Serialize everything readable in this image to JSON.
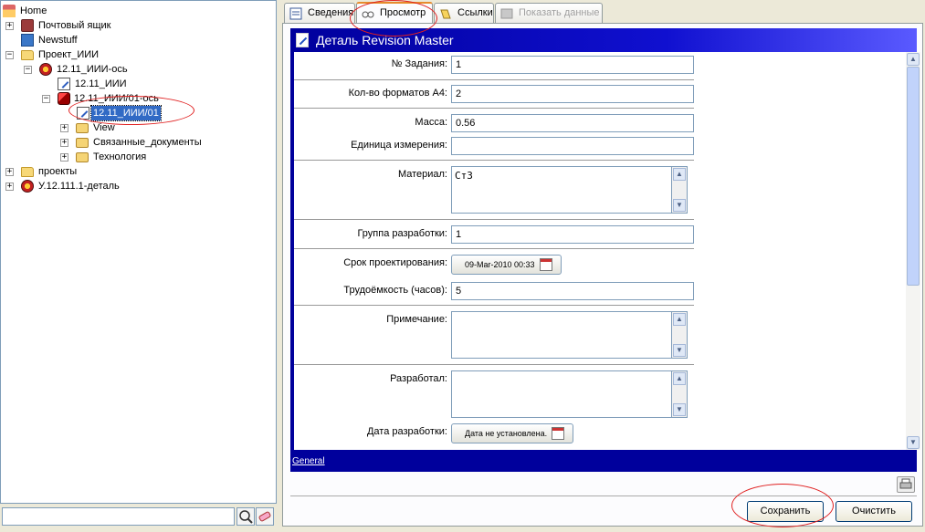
{
  "tree": {
    "items": [
      {
        "label": "Home",
        "icon": "home-icon"
      },
      {
        "label": "Почтовый ящик",
        "icon": "mailbox-icon"
      },
      {
        "label": "Newstuff",
        "icon": "newstuff-icon"
      },
      {
        "label": "Проект_ИИИ",
        "icon": "folder-icon"
      },
      {
        "label": "12.11_ИИИ-ось",
        "icon": "revision-icon"
      },
      {
        "label": "12.11_ИИИ",
        "icon": "document-icon"
      },
      {
        "label": "12.11_ИИИ/01-ось",
        "icon": "revision-icon"
      },
      {
        "label": "12.11_ИИИ/01",
        "icon": "document-icon"
      },
      {
        "label": "View",
        "icon": "folder-icon"
      },
      {
        "label": "Связанные_документы",
        "icon": "folder-icon"
      },
      {
        "label": "Технология",
        "icon": "folder-icon"
      },
      {
        "label": "проекты",
        "icon": "folder-icon"
      },
      {
        "label": "У.12.111.1-деталь",
        "icon": "revision-icon"
      }
    ],
    "search_value": ""
  },
  "tabs": [
    {
      "label": "Сведения",
      "icon": "info-icon"
    },
    {
      "label": "Просмотр",
      "icon": "glasses-icon"
    },
    {
      "label": "Ссылки",
      "icon": "links-icon"
    },
    {
      "label": "Показать данные",
      "icon": "data-icon"
    }
  ],
  "form": {
    "title": "Деталь Revision Master",
    "fields": {
      "task_no": {
        "label": "№ Задания:",
        "value": "1"
      },
      "a4_formats": {
        "label": "Кол-во форматов А4:",
        "value": "2"
      },
      "mass": {
        "label": "Масса:",
        "value": "0.56"
      },
      "unit": {
        "label": "Единица измерения:",
        "value": ""
      },
      "material": {
        "label": "Материал:",
        "value": "Ст3"
      },
      "dev_group": {
        "label": "Группа разработки:",
        "value": "1"
      },
      "design_deadline": {
        "label": "Срок проектирования:",
        "value": "09-Mar-2010 00:33"
      },
      "labor_hours": {
        "label": "Трудоёмкость (часов):",
        "value": "5"
      },
      "note": {
        "label": "Примечание:",
        "value": ""
      },
      "developed_by": {
        "label": "Разработал:",
        "value": ""
      },
      "dev_date": {
        "label": "Дата разработки:",
        "value": "Дата не установлена."
      }
    },
    "footer_link": "General"
  },
  "buttons": {
    "save": "Сохранить",
    "clear": "Очистить"
  },
  "colors": {
    "header_blue": "#00009c",
    "selection": "#316ac5",
    "annotation_red": "#e02020"
  }
}
